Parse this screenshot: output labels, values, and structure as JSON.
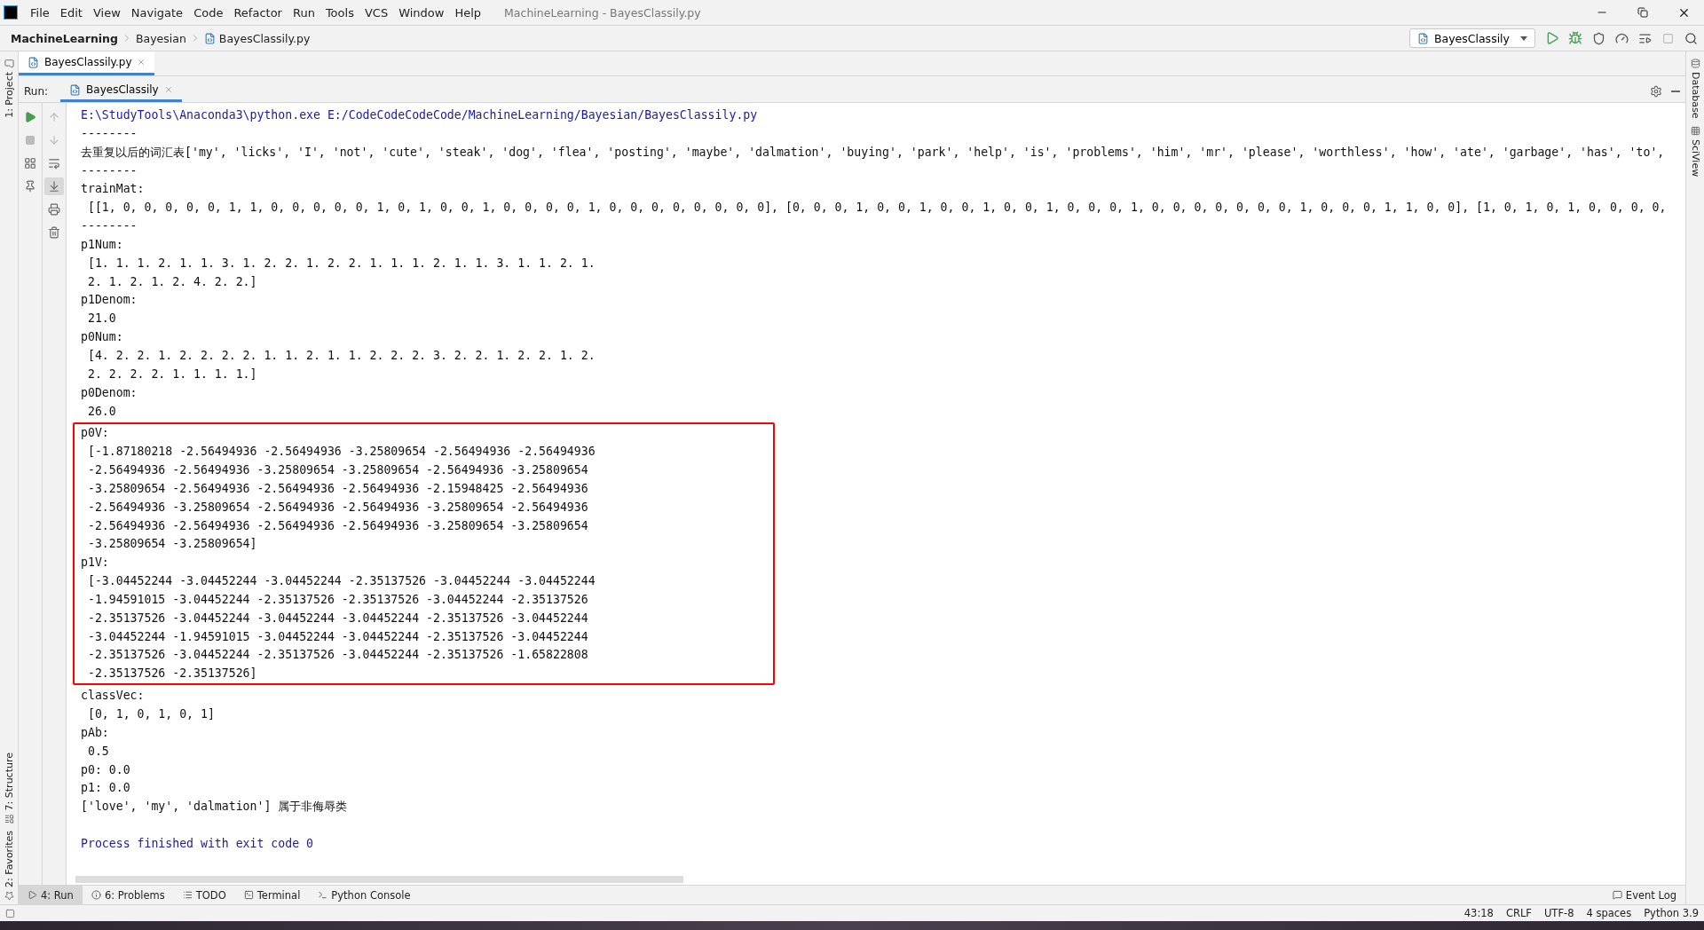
{
  "window": {
    "title": "MachineLearning - BayesClassily.py"
  },
  "menu": [
    "File",
    "Edit",
    "View",
    "Navigate",
    "Code",
    "Refactor",
    "Run",
    "Tools",
    "VCS",
    "Window",
    "Help"
  ],
  "breadcrumbs": [
    {
      "label": "MachineLearning",
      "bold": true
    },
    {
      "label": "Bayesian",
      "bold": false
    },
    {
      "label": "BayesClassily.py",
      "bold": false
    }
  ],
  "run_config": {
    "label": "BayesClassily"
  },
  "left_stripe": {
    "top": [
      "1: Project"
    ],
    "bottom": [
      "7: Structure",
      "2: Favorites"
    ]
  },
  "right_stripe": [
    "Database",
    "SciView"
  ],
  "editor_tabs": [
    {
      "label": "BayesClassily.py",
      "selected": true
    }
  ],
  "run_panel": {
    "label": "Run:",
    "tab": "BayesClassily"
  },
  "console": {
    "sections": [
      {
        "highlighted": false,
        "lines": [
          {
            "kind": "command",
            "text": "E:\\StudyTools\\Anaconda3\\python.exe E:/CodeCodeCodeCode/MachineLearning/Bayesian/BayesClassily.py"
          },
          {
            "kind": "output",
            "text": "--------"
          },
          {
            "kind": "output",
            "text": "去重复以后的词汇表['my', 'licks', 'I', 'not', 'cute', 'steak', 'dog', 'flea', 'posting', 'maybe', 'dalmation', 'buying', 'park', 'help', 'is', 'problems', 'him', 'mr', 'please', 'worthless', 'how', 'ate', 'garbage', 'has', 'to',"
          },
          {
            "kind": "output",
            "text": "--------"
          },
          {
            "kind": "output",
            "text": "trainMat:"
          },
          {
            "kind": "output",
            "text": " [[1, 0, 0, 0, 0, 0, 1, 1, 0, 0, 0, 0, 0, 1, 0, 1, 0, 0, 1, 0, 0, 0, 0, 1, 0, 0, 0, 0, 0, 0, 0, 0], [0, 0, 0, 1, 0, 0, 1, 0, 0, 1, 0, 0, 1, 0, 0, 0, 1, 0, 0, 0, 0, 0, 0, 0, 1, 0, 0, 0, 1, 1, 0, 0], [1, 0, 1, 0, 1, 0, 0, 0, 0,"
          },
          {
            "kind": "output",
            "text": "--------"
          },
          {
            "kind": "output",
            "text": "p1Num:"
          },
          {
            "kind": "output",
            "text": " [1. 1. 1. 2. 1. 1. 3. 1. 2. 2. 1. 2. 2. 1. 1. 1. 2. 1. 1. 3. 1. 1. 2. 1."
          },
          {
            "kind": "output",
            "text": " 2. 1. 2. 1. 2. 4. 2. 2.]"
          },
          {
            "kind": "output",
            "text": "p1Denom:"
          },
          {
            "kind": "output",
            "text": " 21.0"
          },
          {
            "kind": "output",
            "text": "p0Num:"
          },
          {
            "kind": "output",
            "text": " [4. 2. 2. 1. 2. 2. 2. 2. 1. 1. 2. 1. 1. 2. 2. 2. 3. 2. 2. 1. 2. 2. 1. 2."
          },
          {
            "kind": "output",
            "text": " 2. 2. 2. 2. 1. 1. 1. 1.]"
          },
          {
            "kind": "output",
            "text": "p0Denom:"
          },
          {
            "kind": "output",
            "text": " 26.0"
          }
        ]
      },
      {
        "highlighted": true,
        "lines": [
          {
            "kind": "output",
            "text": "p0V:"
          },
          {
            "kind": "output",
            "text": " [-1.87180218 -2.56494936 -2.56494936 -3.25809654 -2.56494936 -2.56494936"
          },
          {
            "kind": "output",
            "text": " -2.56494936 -2.56494936 -3.25809654 -3.25809654 -2.56494936 -3.25809654"
          },
          {
            "kind": "output",
            "text": " -3.25809654 -2.56494936 -2.56494936 -2.56494936 -2.15948425 -2.56494936"
          },
          {
            "kind": "output",
            "text": " -2.56494936 -3.25809654 -2.56494936 -2.56494936 -3.25809654 -2.56494936"
          },
          {
            "kind": "output",
            "text": " -2.56494936 -2.56494936 -2.56494936 -2.56494936 -3.25809654 -3.25809654"
          },
          {
            "kind": "output",
            "text": " -3.25809654 -3.25809654]"
          },
          {
            "kind": "output",
            "text": "p1V:"
          },
          {
            "kind": "output",
            "text": " [-3.04452244 -3.04452244 -3.04452244 -2.35137526 -3.04452244 -3.04452244"
          },
          {
            "kind": "output",
            "text": " -1.94591015 -3.04452244 -2.35137526 -2.35137526 -3.04452244 -2.35137526"
          },
          {
            "kind": "output",
            "text": " -2.35137526 -3.04452244 -3.04452244 -3.04452244 -2.35137526 -3.04452244"
          },
          {
            "kind": "output",
            "text": " -3.04452244 -1.94591015 -3.04452244 -3.04452244 -2.35137526 -3.04452244"
          },
          {
            "kind": "output",
            "text": " -2.35137526 -3.04452244 -2.35137526 -3.04452244 -2.35137526 -1.65822808"
          },
          {
            "kind": "output",
            "text": " -2.35137526 -2.35137526]"
          }
        ]
      },
      {
        "highlighted": false,
        "lines": [
          {
            "kind": "output",
            "text": "classVec:"
          },
          {
            "kind": "output",
            "text": " [0, 1, 0, 1, 0, 1]"
          },
          {
            "kind": "output",
            "text": "pAb:"
          },
          {
            "kind": "output",
            "text": " 0.5"
          },
          {
            "kind": "output",
            "text": "p0: 0.0"
          },
          {
            "kind": "output",
            "text": "p1: 0.0"
          },
          {
            "kind": "output",
            "text": "['love', 'my', 'dalmation'] 属于非侮辱类"
          },
          {
            "kind": "blank"
          },
          {
            "kind": "exit",
            "text": "Process finished with exit code 0"
          }
        ]
      }
    ]
  },
  "tool_tabs": [
    {
      "kind": "run",
      "label": "4: Run",
      "selected": true
    },
    {
      "kind": "problems",
      "label": "6: Problems",
      "selected": false
    },
    {
      "kind": "todo",
      "label": "TODO",
      "selected": false
    },
    {
      "kind": "terminal",
      "label": "Terminal",
      "selected": false
    },
    {
      "kind": "console",
      "label": "Python Console",
      "selected": false
    }
  ],
  "event_log": "Event Log",
  "status_bar": [
    "43:18",
    "CRLF",
    "UTF-8",
    "4 spaces",
    "Python 3.9"
  ]
}
